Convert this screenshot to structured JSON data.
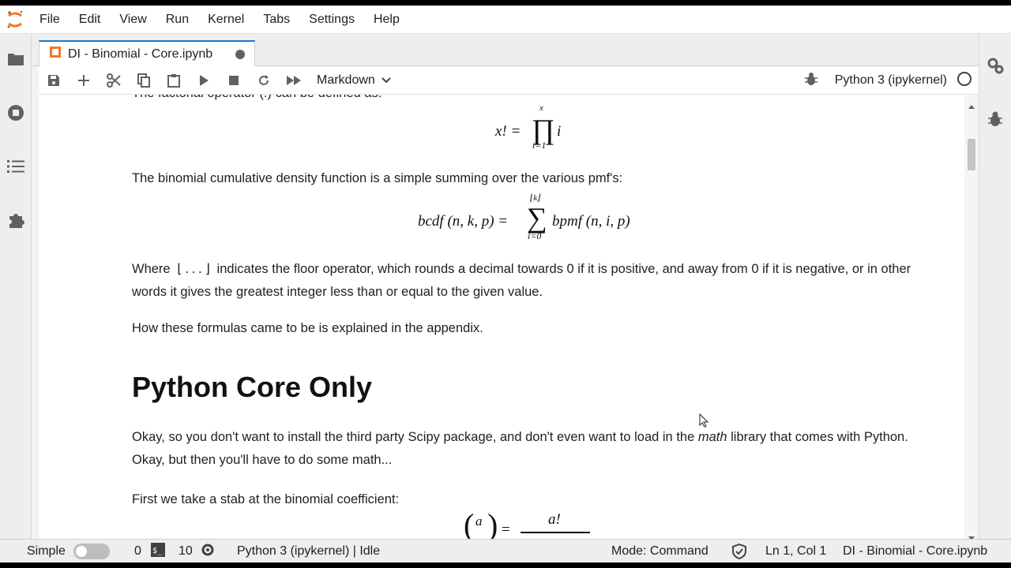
{
  "menubar": {
    "items": [
      "File",
      "Edit",
      "View",
      "Run",
      "Kernel",
      "Tabs",
      "Settings",
      "Help"
    ]
  },
  "left_sidebar": {
    "icons": [
      "folder-icon",
      "running-stop-icon",
      "toc-list-icon",
      "extension-puzzle-icon"
    ]
  },
  "right_sidebar": {
    "icons": [
      "property-inspector-gears-icon",
      "debugger-bug-icon"
    ]
  },
  "tab": {
    "title": "DI - Binomial - Core.ipynb"
  },
  "toolbar": {
    "cell_type": "Markdown",
    "kernel_name": "Python 3 (ipykernel)"
  },
  "content": {
    "top_clipped": "The factorial operator (!) can be defined as:",
    "factorial_lhs": "x! =",
    "factorial_prod_top": "x",
    "factorial_prod_bottom": "i=1",
    "factorial_rhs": "i",
    "cdf_intro": "The binomial cumulative density function is a simple summing over the various pmf's:",
    "cdf_lhs": "bcdf (n, k, p) =",
    "cdf_sum_top": "⌊k⌋",
    "cdf_sum_bottom": "i=0",
    "cdf_rhs": "bpmf (n, i, p)",
    "floor_text_pre": "Where",
    "floor_symbol": "⌊ . . . ⌋",
    "floor_text_post": "indicates the floor operator, which rounds a decimal towards 0 if it is positive, and away from 0 if it is negative, or in other words it gives the greatest integer less than or equal to the given value.",
    "appendix": "How these formulas came to be is explained in the appendix.",
    "heading": "Python Core Only",
    "core_pre": "Okay, so you don't want to install the third party Scipy package, and don't even want to load in the",
    "core_em": "math",
    "core_post": "library that comes with Python. Okay, but then you'll have to do some math...",
    "coef_intro": "First we take a stab at the binomial coefficient:",
    "coef_top": "a",
    "coef_eq": "=",
    "coef_num": "a!"
  },
  "statusbar": {
    "mode_simple": "Simple",
    "terminals": "0",
    "kernels": "10",
    "kernel_status": "Python 3 (ipykernel) | Idle",
    "mode": "Mode: Command",
    "cursor": "Ln 1, Col 1",
    "file": "DI - Binomial - Core.ipynb"
  },
  "colors": {
    "accent": "#1976d2",
    "jupyter_orange": "#f37726",
    "icon_gray": "#616161"
  }
}
